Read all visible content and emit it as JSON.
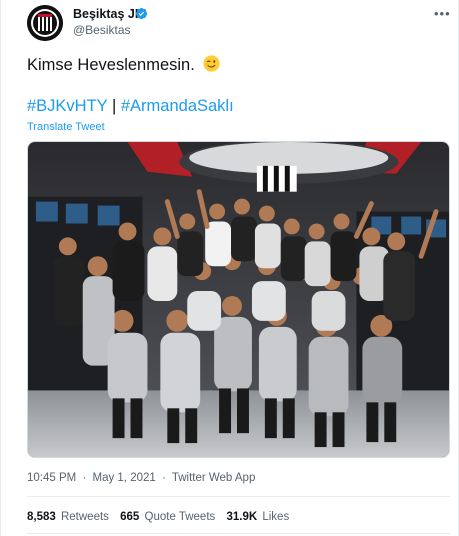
{
  "account": {
    "display_name": "Beşiktaş JK",
    "handle": "@Besiktas",
    "verified": true,
    "avatar_icon": "besiktas-crest-icon"
  },
  "tweet": {
    "text": "Kimse Heveslenmesin.",
    "emoji_icon": "winking-face-icon",
    "hashtag_1": "#BJKvHTY",
    "separator": "|",
    "hashtag_2": "#ArmandaSaklı",
    "translate_label": "Translate Tweet",
    "image_icon": "team-celebration-photo"
  },
  "meta": {
    "time": "10:45 PM",
    "dot_1": "·",
    "date": "May 1, 2021",
    "dot_2": "·",
    "source": "Twitter Web App"
  },
  "stats": {
    "retweets_count": "8,583",
    "retweets_label": "Retweets",
    "quotes_count": "665",
    "quotes_label": "Quote Tweets",
    "likes_count": "31.9K",
    "likes_label": "Likes"
  },
  "colors": {
    "link": "#1d9bf0",
    "text": "#0f1419",
    "secondary": "#536471",
    "verified": "#1d9bf0"
  }
}
